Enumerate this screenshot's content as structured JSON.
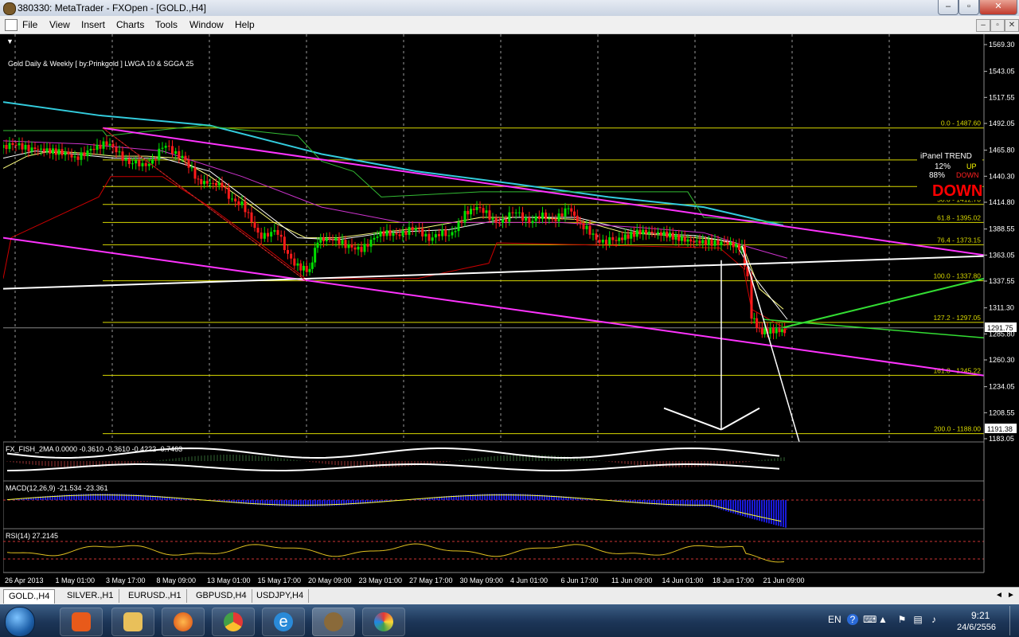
{
  "window": {
    "title": "380330: MetaTrader - FXOpen - [GOLD.,H4]",
    "buttons": [
      "–",
      "▫",
      "✕"
    ]
  },
  "menu": [
    "File",
    "View",
    "Insert",
    "Charts",
    "Tools",
    "Window",
    "Help"
  ],
  "mdi_buttons": [
    "–",
    "▫",
    "✕"
  ],
  "chart": {
    "header": "Gold Daily & Weekly [ by:Prinkgold ]  LWGA 10  &  SGGA 25",
    "current_price": "1291.75",
    "bottom_price_label": "1191.38",
    "price_axis": [
      "1569.30",
      "1543.05",
      "1517.55",
      "1492.05",
      "1465.80",
      "1440.30",
      "1414.80",
      "1388.55",
      "1363.05",
      "1337.55",
      "1311.30",
      "1285.80",
      "1260.30",
      "1234.05",
      "1208.55",
      "1183.05"
    ],
    "fib_levels": [
      {
        "label": "0.0 - 1487.60"
      },
      {
        "label": "23.6 - 1456.25"
      },
      {
        "label": "38.2 - 1430.18"
      },
      {
        "label": "50.0 - 1412.70"
      },
      {
        "label": "61.8 - 1395.02"
      },
      {
        "label": "76.4 - 1373.15"
      },
      {
        "label": "100.0 - 1337.80"
      },
      {
        "label": "127.2 - 1297.05"
      },
      {
        "label": "161.8 - 1245.22"
      },
      {
        "label": "200.0 - 1188.00"
      }
    ],
    "ipanel": {
      "title": "iPanel  TREND",
      "up_pct": "12%",
      "up_label": "UP",
      "down_pct": "88%",
      "down_label": "DOWN",
      "signal": "DOWN"
    },
    "date_axis": [
      "26 Apr 2013",
      "1 May 01:00",
      "3 May 17:00",
      "8 May 09:00",
      "13 May 01:00",
      "15 May 17:00",
      "20 May 09:00",
      "23 May 01:00",
      "27 May 17:00",
      "30 May 09:00",
      "4 Jun 01:00",
      "6 Jun 17:00",
      "11 Jun 09:00",
      "14 Jun 01:00",
      "18 Jun 17:00",
      "21 Jun 09:00"
    ]
  },
  "indicators": {
    "fx_fish": {
      "label": "FX_FISH_2MA 0.0000 -0.3610 -0.3610 -0.4222 -0.7463",
      "axis": [
        "1.5627",
        "0.00",
        "-1.9601"
      ]
    },
    "macd": {
      "label": "MACD(12,26,9) -21.534 -23.361",
      "axis": [
        "16.613",
        "0.00",
        "-26.499"
      ]
    },
    "rsi": {
      "label": "RSI(14) 27.2145",
      "axis": [
        "100",
        "70",
        "30",
        "0"
      ]
    }
  },
  "tabs": [
    "GOLD.,H4",
    "SILVER.,H1",
    "EURUSD.,H1",
    "GBPUSD,H4",
    "USDJPY,H4"
  ],
  "taskbar": {
    "apps": [
      "media-player",
      "explorer",
      "firefox",
      "chrome",
      "internet-explorer",
      "metatrader",
      "paint"
    ],
    "lang": "EN",
    "time": "9:21",
    "date": "24/6/2556"
  },
  "colors": {
    "bull": "#00e000",
    "bear": "#ff1a1a",
    "fib": "#d8d800",
    "channel": "#ff33ff",
    "trend": "#ffffff",
    "ma_cyan": "#33ccdd"
  }
}
